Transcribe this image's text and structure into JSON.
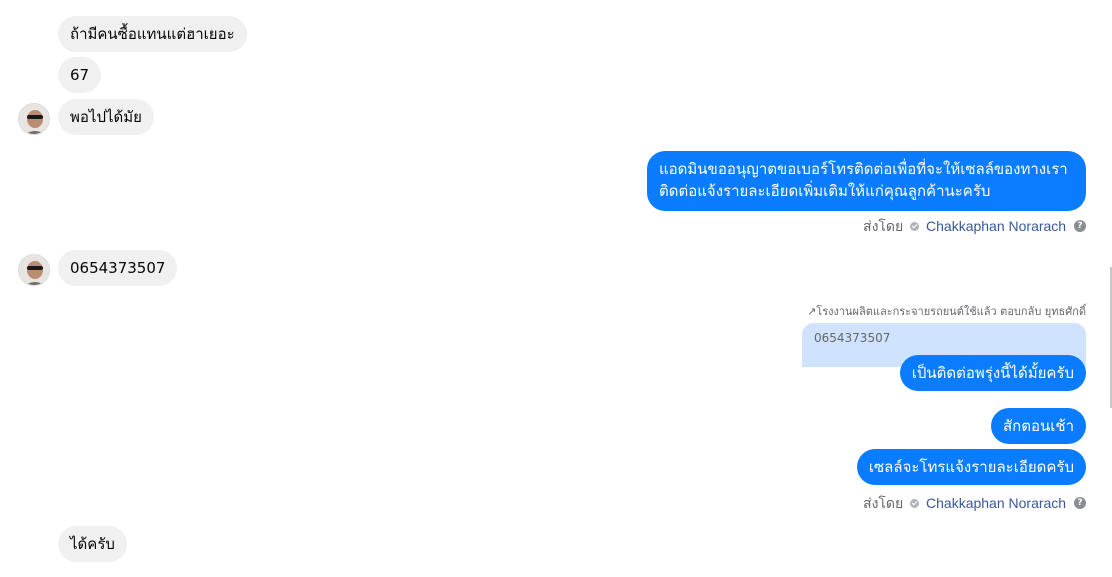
{
  "conversation": {
    "incoming": [
      {
        "text": "ถ้ามีคนซื้อแทนแต่ฮาเยอะ"
      },
      {
        "text": "67"
      },
      {
        "text": "พอไปได้มัย"
      },
      {
        "text": "0654373507"
      },
      {
        "text": "ได้ครับ"
      }
    ],
    "outgoing": {
      "admin_message": "แอดมินขออนุญาตขอเบอร์โทรติดต่อเพื่อที่จะให้เซลล์ของทางเราติดต่อแจ้งรายละเอียดเพิ่มเติมให้แก่คุณลูกค้านะครับ",
      "reply_text": "เป็นติดต่อพรุ่งนี้ได้มั้ยครับ",
      "morning": "สักตอนเช้า",
      "sales_call": "เซลล์จะโทรแจ้งรายละเอียดครับ"
    },
    "sent_by": {
      "label": "ส่งโดย",
      "name": "Chakkaphan Norarach",
      "help": "?"
    },
    "reply": {
      "meta": "↗โรงงานผลิตและกระจายรถยนต์ใช้แล้ว ตอบกลับ ยุทธศักดิ์",
      "quoted_text": "0654373507"
    }
  },
  "colors": {
    "outgoing_bubble": "#0a7cff",
    "incoming_bubble": "#f0f0f0",
    "quoted_bubble": "#cfe3fe",
    "sender_name": "#385898"
  }
}
